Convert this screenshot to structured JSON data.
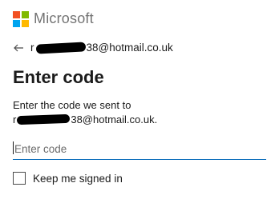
{
  "brand": {
    "name": "Microsoft",
    "logo_colors": [
      "#f25022",
      "#7fba00",
      "#00a4ef",
      "#ffb900"
    ]
  },
  "identity": {
    "prefix": "r",
    "suffix": "38@hotmail.co.uk"
  },
  "title": "Enter code",
  "description": {
    "line1": "Enter the code we sent to",
    "email_prefix": "r",
    "email_suffix": "38@hotmail.co.uk."
  },
  "code_input": {
    "placeholder": "Enter code",
    "value": ""
  },
  "keep_signed_in": {
    "label": "Keep me signed in",
    "checked": false
  },
  "colors": {
    "accent": "#0067b8",
    "text": "#1b1b1b",
    "brand_gray": "#737373"
  }
}
